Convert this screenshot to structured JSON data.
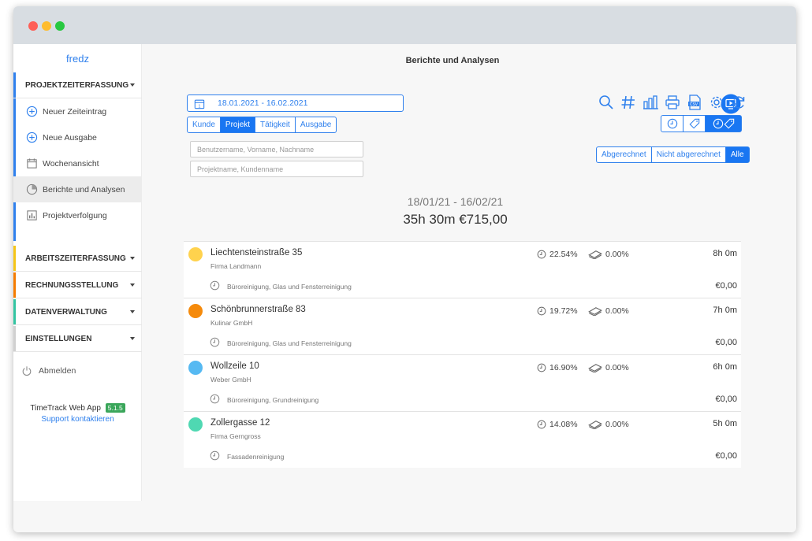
{
  "sidebar": {
    "username": "fredz",
    "sections": [
      {
        "label": "PROJEKTZEITERFASSUNG",
        "color": "#2f80ed"
      },
      {
        "label": "ARBEITSZEITERFASSUNG",
        "color": "#f5c518"
      },
      {
        "label": "RECHNUNGSSTELLUNG",
        "color": "#f57c00"
      },
      {
        "label": "DATENVERWALTUNG",
        "color": "#33c4a1"
      },
      {
        "label": "EINSTELLUNGEN",
        "color": "#cccccc"
      }
    ],
    "items": [
      {
        "label": "Neuer Zeiteintrag",
        "icon": "plus-circle-icon"
      },
      {
        "label": "Neue Ausgabe",
        "icon": "plus-circle-icon"
      },
      {
        "label": "Wochenansicht",
        "icon": "calendar-icon"
      },
      {
        "label": "Berichte und Analysen",
        "icon": "pie-chart-icon"
      },
      {
        "label": "Projektverfolgung",
        "icon": "bar-chart-icon"
      }
    ],
    "logout": "Abmelden",
    "app_name": "TimeTrack Web App",
    "version": "5.1.5",
    "support": "Support kontaktieren"
  },
  "main": {
    "title": "Berichte und Analysen",
    "date_range": "18.01.2021 - 16.02.2021",
    "filter_tabs": [
      "Kunde",
      "Projekt",
      "Tätigkeit",
      "Ausgabe"
    ],
    "active_filter_tab": "Projekt",
    "user_placeholder": "Benutzername, Vorname, Nachname",
    "project_placeholder": "Projektname, Kundenname",
    "billing_tabs": [
      "Abgerechnet",
      "Nicht abgerechnet",
      "Alle"
    ],
    "active_billing_tab": "Alle",
    "toolbar_icons": [
      "search-icon",
      "hash-icon",
      "bar-chart-icon",
      "print-icon",
      "csv-icon",
      "gear-icon",
      "refresh-icon"
    ],
    "summary_range": "18/01/21 - 16/02/21",
    "summary_total": "35h 30m   €715,00"
  },
  "rows": [
    {
      "name": "Liechtensteinstraße 35",
      "company": "Firma Landmann",
      "activity": "Büroreinigung, Glas und Fensterreinigung",
      "time_pct": "22.54%",
      "money_pct": "0.00%",
      "hours": "8h 0m",
      "amount": "€0,00",
      "color": "#ffd24d"
    },
    {
      "name": "Schönbrunnerstraße 83",
      "company": "Kulinar GmbH",
      "activity": "Büroreinigung, Glas und Fensterreinigung",
      "time_pct": "19.72%",
      "money_pct": "0.00%",
      "hours": "7h 0m",
      "amount": "€0,00",
      "color": "#f58a0b"
    },
    {
      "name": "Wollzeile 10",
      "company": "Weber GmbH",
      "activity": "Büroreinigung, Grundreinigung",
      "time_pct": "16.90%",
      "money_pct": "0.00%",
      "hours": "6h 0m",
      "amount": "€0,00",
      "color": "#56b9f2"
    },
    {
      "name": "Zollergasse 12",
      "company": "Firma Gerngross",
      "activity": "Fassadenreinigung",
      "time_pct": "14.08%",
      "money_pct": "0.00%",
      "hours": "5h 0m",
      "amount": "€0,00",
      "color": "#4fd8b2"
    }
  ]
}
